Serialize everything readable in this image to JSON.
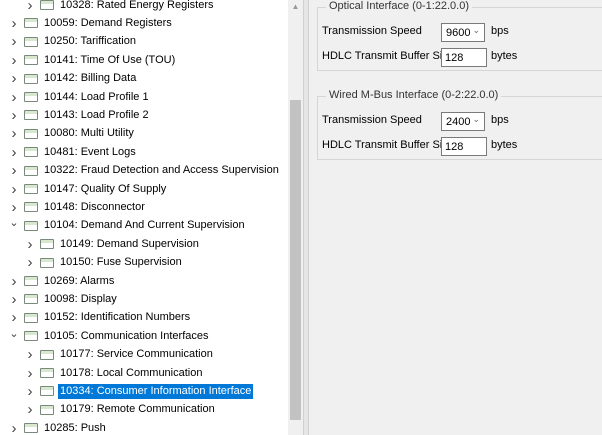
{
  "tree": {
    "items": [
      {
        "label": "10328: Rated Energy Registers",
        "level": 1,
        "expander": "collapsed",
        "selected": false
      },
      {
        "label": "10059: Demand Registers",
        "level": 0,
        "expander": "collapsed",
        "selected": false
      },
      {
        "label": "10250: Tariffication",
        "level": 0,
        "expander": "collapsed",
        "selected": false
      },
      {
        "label": "10141: Time Of Use (TOU)",
        "level": 0,
        "expander": "collapsed",
        "selected": false
      },
      {
        "label": "10142: Billing Data",
        "level": 0,
        "expander": "collapsed",
        "selected": false
      },
      {
        "label": "10144: Load Profile 1",
        "level": 0,
        "expander": "collapsed",
        "selected": false
      },
      {
        "label": "10143: Load Profile 2",
        "level": 0,
        "expander": "collapsed",
        "selected": false
      },
      {
        "label": "10080: Multi Utility",
        "level": 0,
        "expander": "collapsed",
        "selected": false
      },
      {
        "label": "10481: Event Logs",
        "level": 0,
        "expander": "collapsed",
        "selected": false
      },
      {
        "label": "10322: Fraud Detection and Access Supervision",
        "level": 0,
        "expander": "collapsed",
        "selected": false
      },
      {
        "label": "10147: Quality Of Supply",
        "level": 0,
        "expander": "collapsed",
        "selected": false
      },
      {
        "label": "10148: Disconnector",
        "level": 0,
        "expander": "collapsed",
        "selected": false
      },
      {
        "label": "10104: Demand And Current Supervision",
        "level": 0,
        "expander": "expanded",
        "selected": false
      },
      {
        "label": "10149: Demand Supervision",
        "level": 1,
        "expander": "collapsed",
        "selected": false
      },
      {
        "label": "10150: Fuse Supervision",
        "level": 1,
        "expander": "collapsed",
        "selected": false
      },
      {
        "label": "10269: Alarms",
        "level": 0,
        "expander": "collapsed",
        "selected": false
      },
      {
        "label": "10098: Display",
        "level": 0,
        "expander": "collapsed",
        "selected": false
      },
      {
        "label": "10152: Identification Numbers",
        "level": 0,
        "expander": "collapsed",
        "selected": false
      },
      {
        "label": "10105: Communication Interfaces",
        "level": 0,
        "expander": "expanded",
        "selected": false
      },
      {
        "label": "10177: Service Communication",
        "level": 1,
        "expander": "collapsed",
        "selected": false
      },
      {
        "label": "10178: Local Communication",
        "level": 1,
        "expander": "collapsed",
        "selected": false
      },
      {
        "label": "10334: Consumer Information Interface",
        "level": 1,
        "expander": "collapsed",
        "selected": true
      },
      {
        "label": "10179: Remote Communication",
        "level": 1,
        "expander": "collapsed",
        "selected": false
      },
      {
        "label": "10285: Push",
        "level": 0,
        "expander": "collapsed",
        "selected": false
      }
    ]
  },
  "optical": {
    "title": "Optical Interface (0-1:22.0.0)",
    "speed_label": "Transmission Speed",
    "speed_value": "9600",
    "speed_unit": "bps",
    "buffer_label": "HDLC Transmit Buffer Size",
    "buffer_value": "128",
    "buffer_unit": "bytes"
  },
  "mbus": {
    "title": "Wired M-Bus Interface (0-2:22.0.0)",
    "speed_label": "Transmission Speed",
    "speed_value": "2400",
    "speed_unit": "bps",
    "buffer_label": "HDLC Transmit Buffer Size",
    "buffer_value": "128",
    "buffer_unit": "bytes"
  },
  "icons": {
    "expander_collapsed": "chevron-right-icon",
    "expander_expanded": "chevron-down-icon",
    "node": "folder-node-icon",
    "combo_arrow": "chevron-down-icon"
  },
  "colors": {
    "selection": "#0078d7",
    "panel_bg": "#f0f0f0"
  }
}
